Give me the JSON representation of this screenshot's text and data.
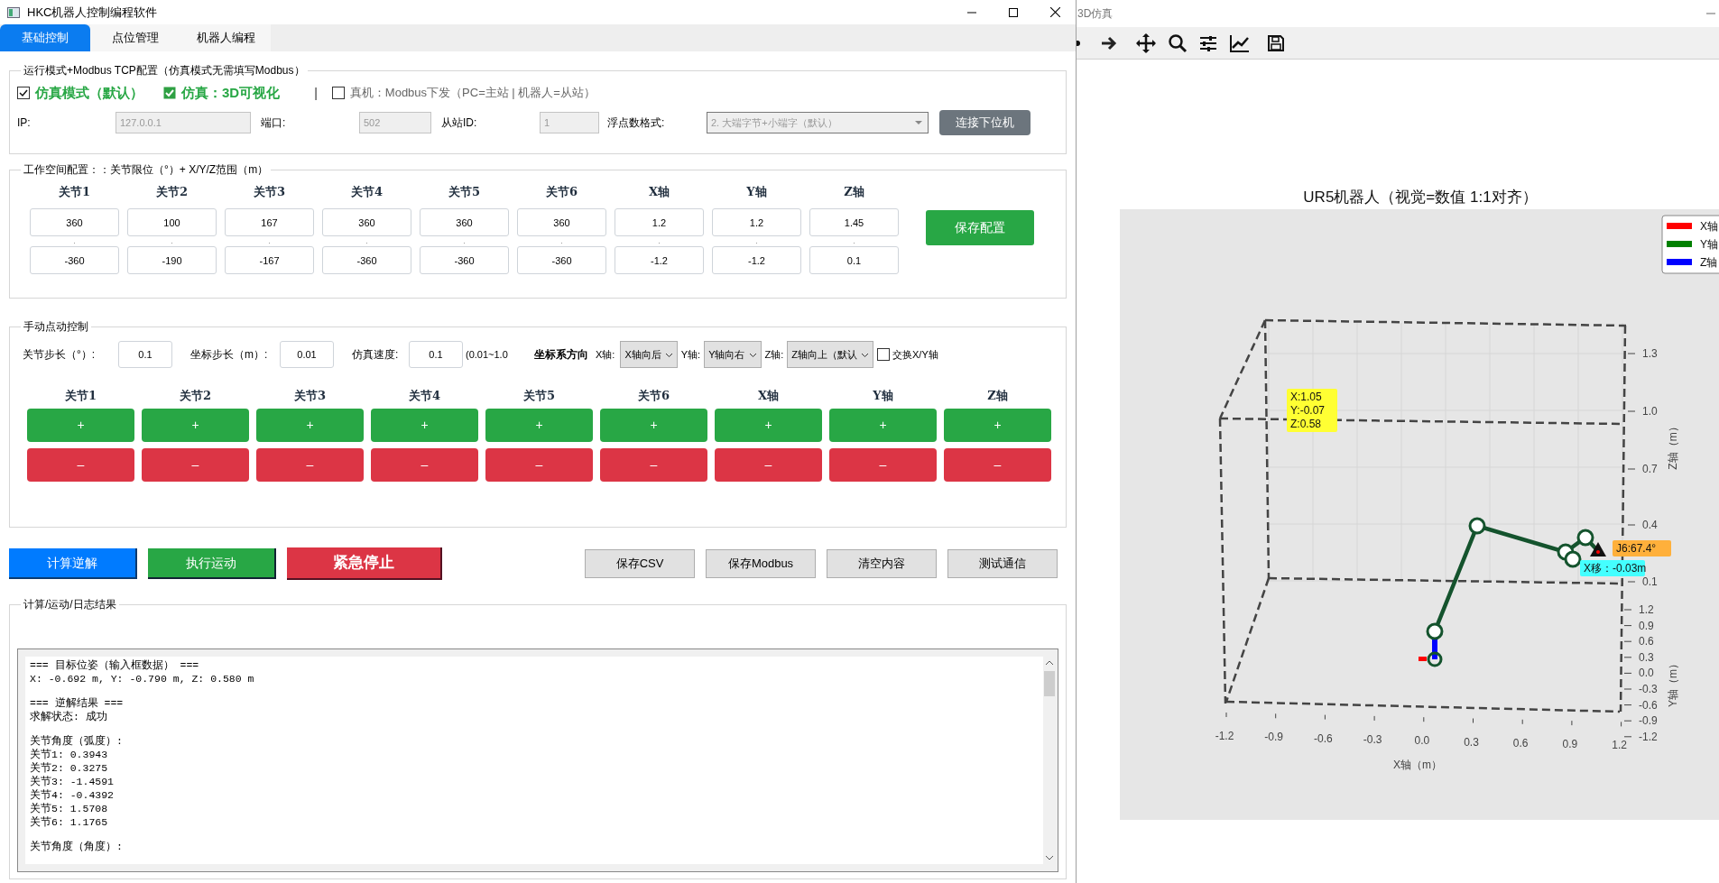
{
  "window": {
    "title": "HKC机器人控制编程软件"
  },
  "tabs": [
    {
      "label": "基础控制",
      "selected": true
    },
    {
      "label": "点位管理",
      "selected": false
    },
    {
      "label": "机器人编程",
      "selected": false
    }
  ],
  "mode_group": {
    "title": "运行模式+Modbus TCP配置（仿真模式无需填写Modbus）",
    "options": [
      {
        "kind": "checkbox",
        "label": "仿真模式（默认）",
        "checked": true
      },
      {
        "kind": "tickbox",
        "label": "仿真：3D可视化",
        "checked": true
      },
      {
        "kind": "separator",
        "label": "|"
      },
      {
        "kind": "checkbox",
        "label": "真机：Modbus下发（PC=主站 | 机器人=从站）",
        "checked": false
      }
    ],
    "fields": [
      {
        "label": "IP:",
        "value": "127.0.0.1",
        "disabled": true
      },
      {
        "label": "端口:",
        "value": "502",
        "disabled": true
      },
      {
        "label": "从站ID:",
        "value": "1",
        "disabled": true
      }
    ],
    "float_format": {
      "label": "浮点数格式:",
      "value": "2. 大端字节+小端字（默认）",
      "disabled": true
    },
    "connect_button": "连接下位机"
  },
  "workspace": {
    "title": "工作空间配置：：关节限位（°）+ X/Y/Z范围（m）",
    "range_mark": ".",
    "columns": [
      {
        "label": "关节1",
        "max": "360",
        "min": "-360"
      },
      {
        "label": "关节2",
        "max": "100",
        "min": "-190"
      },
      {
        "label": "关节3",
        "max": "167",
        "min": "-167"
      },
      {
        "label": "关节4",
        "max": "360",
        "min": "-360"
      },
      {
        "label": "关节5",
        "max": "360",
        "min": "-360"
      },
      {
        "label": "关节6",
        "max": "360",
        "min": "-360"
      },
      {
        "label": "X轴",
        "max": "1.2",
        "min": "-1.2"
      },
      {
        "label": "Y轴",
        "max": "1.2",
        "min": "-1.2"
      },
      {
        "label": "Z轴",
        "max": "1.45",
        "min": "0.1"
      }
    ],
    "save_button": "保存配置"
  },
  "jog": {
    "title": "手动点动控制",
    "params": [
      {
        "label": "关节步长（°）:",
        "value": "0.1"
      },
      {
        "label": "坐标步长（m）:",
        "value": "0.01"
      },
      {
        "label": "仿真速度:",
        "value": "0.1"
      }
    ],
    "speed_hint": "(0.01~1.0",
    "orientation": {
      "label": "坐标系方向",
      "x_label": "X轴:",
      "selects": [
        {
          "value": "X轴向后",
          "next_label": "Y轴:"
        },
        {
          "value": "Y轴向右",
          "next_label": "Z轴:"
        },
        {
          "value": "Z轴向上（默认"
        }
      ],
      "swap": {
        "label": "交换X/Y轴",
        "checked": false
      }
    },
    "columns": [
      "关节1",
      "关节2",
      "关节3",
      "关节4",
      "关节5",
      "关节6",
      "X轴",
      "Y轴",
      "Z轴"
    ],
    "plus_label": "+",
    "minus_label": "–"
  },
  "actions": [
    {
      "kind": "primary",
      "label": "计算逆解"
    },
    {
      "kind": "success",
      "label": "执行运动"
    },
    {
      "kind": "danger",
      "label": "紧急停止"
    }
  ],
  "tools": [
    "保存CSV",
    "保存Modbus",
    "清空内容",
    "测试通信"
  ],
  "log": {
    "title": "计算/运动/日志结果",
    "blocks": [
      [
        "=== 目标位姿（输入框数据） ===",
        "X: -0.692 m, Y: -0.790 m, Z: 0.580 m"
      ],
      [
        "=== 逆解结果 ===",
        "求解状态: 成功"
      ],
      [
        "关节角度（弧度）:",
        "关节1: 0.3943",
        "关节2: 0.3275",
        "关节3: -1.4591",
        "关节4: -0.4392",
        "关节5: 1.5708",
        "关节6: 1.1765"
      ],
      [
        "关节角度（角度）:"
      ]
    ]
  },
  "sim": {
    "title": "3D仿真",
    "plot": {
      "title": "UR5机器人（视觉=数值 1:1对齐）",
      "legend": [
        {
          "label": "X轴",
          "color": "#ff0000"
        },
        {
          "label": "Y轴",
          "color": "#008000"
        },
        {
          "label": "Z轴",
          "color": "#0000ff"
        }
      ],
      "z_ticks": [
        "1.3",
        "1.0",
        "0.7",
        "0.4",
        "0.1"
      ],
      "y_ticks": [
        "1.2",
        "0.9",
        "0.6",
        "0.3",
        "0.0",
        "-0.3",
        "-0.6",
        "-0.9",
        "-1.2"
      ],
      "x_ticks": [
        "-1.2",
        "-0.9",
        "-0.6",
        "-0.3",
        "0.0",
        "0.3",
        "0.6",
        "0.9",
        "1.2"
      ],
      "x_label": "X轴（m）",
      "z_label": "Z轴（m）",
      "y_label": "Y轴（m）",
      "tags": [
        {
          "lines": [
            "X:1.05",
            "Y:-0.07",
            "Z:0.58"
          ],
          "color": "#ffff33"
        },
        {
          "lines": [
            "J6:67.4°"
          ],
          "color": "#ffb03b"
        },
        {
          "lines": [
            "X移：-0.03m"
          ],
          "color": "#44ffff"
        }
      ]
    }
  }
}
